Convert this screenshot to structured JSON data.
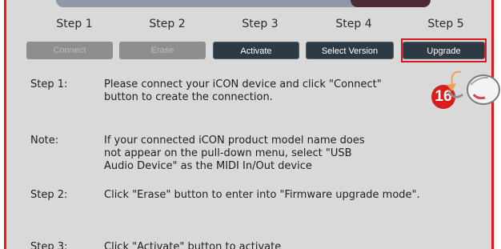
{
  "steps": [
    {
      "heading": "Step 1",
      "button": "Connect",
      "state": "disabled"
    },
    {
      "heading": "Step 2",
      "button": "Erase",
      "state": "disabled"
    },
    {
      "heading": "Step 3",
      "button": "Activate",
      "state": "active"
    },
    {
      "heading": "Step 4",
      "button": "Select Version",
      "state": "active"
    },
    {
      "heading": "Step 5",
      "button": "Upgrade",
      "state": "active"
    }
  ],
  "callout": {
    "number": "16",
    "icon": "mouse-click-icon",
    "accent": "#d81f1f"
  },
  "instructions": [
    {
      "label": "Step 1:",
      "lines": [
        "Please connect your iCON device and click \"Connect\"",
        "button to create the connection."
      ]
    },
    {
      "label": "Note:",
      "lines": [
        "If your connected iCON product model name does",
        "not appear on the pull-down menu, select \"USB",
        "Audio Device\" as the MIDI In/Out device"
      ]
    },
    {
      "label": "Step 2:",
      "lines": [
        "Click \"Erase\" button to enter into \"Firmware upgrade mode\"."
      ]
    },
    {
      "label": "Step 3:",
      "lines": [
        "Click \"Activate\" button to activate"
      ]
    }
  ]
}
